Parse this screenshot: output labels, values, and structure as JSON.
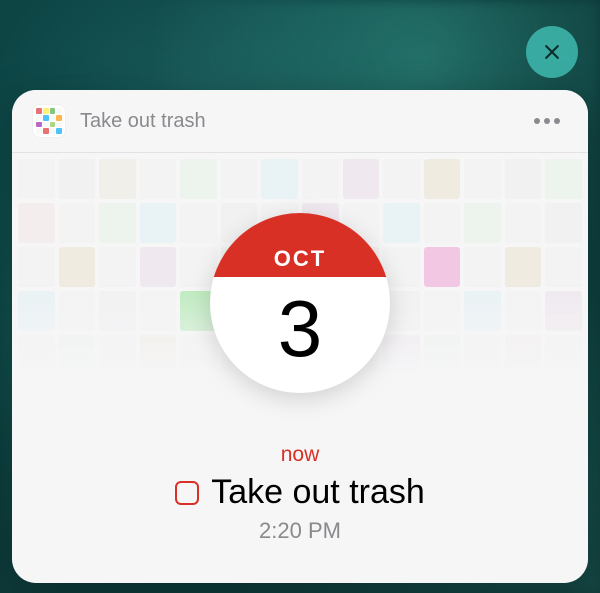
{
  "close": {
    "label": "Close"
  },
  "header": {
    "title": "Take out trash",
    "more_label": "More"
  },
  "calendar": {
    "month": "OCT",
    "day": "3"
  },
  "task": {
    "relative_time": "now",
    "title": "Take out trash",
    "time": "2:20 PM"
  },
  "colors": {
    "accent": "#d93025",
    "close_bg": "#3cb4aa"
  }
}
